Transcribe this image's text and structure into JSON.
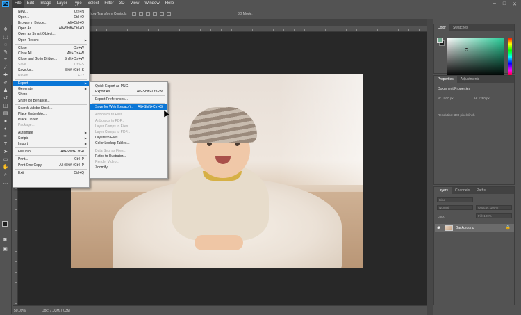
{
  "menubar": {
    "logo": "Ps",
    "items": [
      "File",
      "Edit",
      "Image",
      "Layer",
      "Type",
      "Select",
      "Filter",
      "3D",
      "View",
      "Window",
      "Help"
    ],
    "window_controls": [
      "–",
      "□",
      "✕"
    ]
  },
  "options": {
    "transform_label": "Show Transform Controls",
    "mode3d": "3D Mode:"
  },
  "status": {
    "zoom": "50.09%",
    "doc": "Doc: 7.03M/7.03M"
  },
  "file_menu": [
    {
      "label": "New...",
      "shortcut": "Ctrl+N"
    },
    {
      "label": "Open...",
      "shortcut": "Ctrl+O"
    },
    {
      "label": "Browse in Bridge...",
      "shortcut": "Alt+Ctrl+O"
    },
    {
      "label": "Open As...",
      "shortcut": "Alt+Shift+Ctrl+O"
    },
    {
      "label": "Open as Smart Object...",
      "shortcut": ""
    },
    {
      "label": "Open Recent",
      "shortcut": "",
      "submenu": true
    },
    {
      "label": "Close",
      "shortcut": "Ctrl+W"
    },
    {
      "label": "Close All",
      "shortcut": "Alt+Ctrl+W"
    },
    {
      "label": "Close and Go to Bridge...",
      "shortcut": "Shift+Ctrl+W"
    },
    {
      "label": "Save",
      "shortcut": "Ctrl+S",
      "disabled": true
    },
    {
      "label": "Save As...",
      "shortcut": "Shift+Ctrl+S"
    },
    {
      "label": "Revert",
      "shortcut": "F12",
      "disabled": true
    },
    {
      "label": "Export",
      "shortcut": "",
      "submenu": true,
      "highlight": true
    },
    {
      "label": "Generate",
      "shortcut": "",
      "submenu": true
    },
    {
      "label": "Share...",
      "shortcut": ""
    },
    {
      "label": "Share on Behance...",
      "shortcut": ""
    },
    {
      "label": "Search Adobe Stock...",
      "shortcut": ""
    },
    {
      "label": "Place Embedded...",
      "shortcut": ""
    },
    {
      "label": "Place Linked...",
      "shortcut": ""
    },
    {
      "label": "Package...",
      "shortcut": "",
      "disabled": true
    },
    {
      "label": "Automate",
      "shortcut": "",
      "submenu": true
    },
    {
      "label": "Scripts",
      "shortcut": "",
      "submenu": true
    },
    {
      "label": "Import",
      "shortcut": "",
      "submenu": true
    },
    {
      "label": "File Info...",
      "shortcut": "Alt+Shift+Ctrl+I"
    },
    {
      "label": "Print...",
      "shortcut": "Ctrl+P"
    },
    {
      "label": "Print One Copy",
      "shortcut": "Alt+Shift+Ctrl+P"
    },
    {
      "label": "Exit",
      "shortcut": "Ctrl+Q"
    }
  ],
  "export_menu": [
    {
      "label": "Quick Export as PNG",
      "shortcut": ""
    },
    {
      "label": "Export As...",
      "shortcut": "Alt+Shift+Ctrl+W"
    },
    {
      "label": "Export Preferences...",
      "shortcut": ""
    },
    {
      "label": "Save for Web (Legacy)...",
      "shortcut": "Alt+Shift+Ctrl+S",
      "highlight": true
    },
    {
      "label": "Artboards to Files...",
      "shortcut": "",
      "disabled": true
    },
    {
      "label": "Artboards to PDF...",
      "shortcut": "",
      "disabled": true
    },
    {
      "label": "Layer Comps to Files...",
      "shortcut": "",
      "disabled": true
    },
    {
      "label": "Layer Comps to PDF...",
      "shortcut": "",
      "disabled": true
    },
    {
      "label": "Layers to Files...",
      "shortcut": ""
    },
    {
      "label": "Color Lookup Tables...",
      "shortcut": ""
    },
    {
      "label": "Data Sets as Files...",
      "shortcut": "",
      "disabled": true
    },
    {
      "label": "Paths to Illustrator...",
      "shortcut": ""
    },
    {
      "label": "Render Video...",
      "shortcut": "",
      "disabled": true
    },
    {
      "label": "Zoomify...",
      "shortcut": ""
    }
  ],
  "panels": {
    "color_tabs": [
      "Color",
      "Swatches"
    ],
    "props_tabs": [
      "Properties",
      "Adjustments"
    ],
    "props_title": "Document Properties",
    "w": "W:  1920 px",
    "h": "H:  1280 px",
    "resolution": "Resolution:  300 pixels/inch",
    "layers_tabs": [
      "Layers",
      "Channels",
      "Paths"
    ],
    "kind": "Kind",
    "blend": "Normal",
    "opacity": "Opacity:  100%",
    "lock": "Lock:",
    "fill": "Fill:  100%",
    "layer_name": "Background"
  },
  "colors": {
    "accent": "#0a76d6",
    "panel": "#535353",
    "menu": "#f2f2f2"
  }
}
